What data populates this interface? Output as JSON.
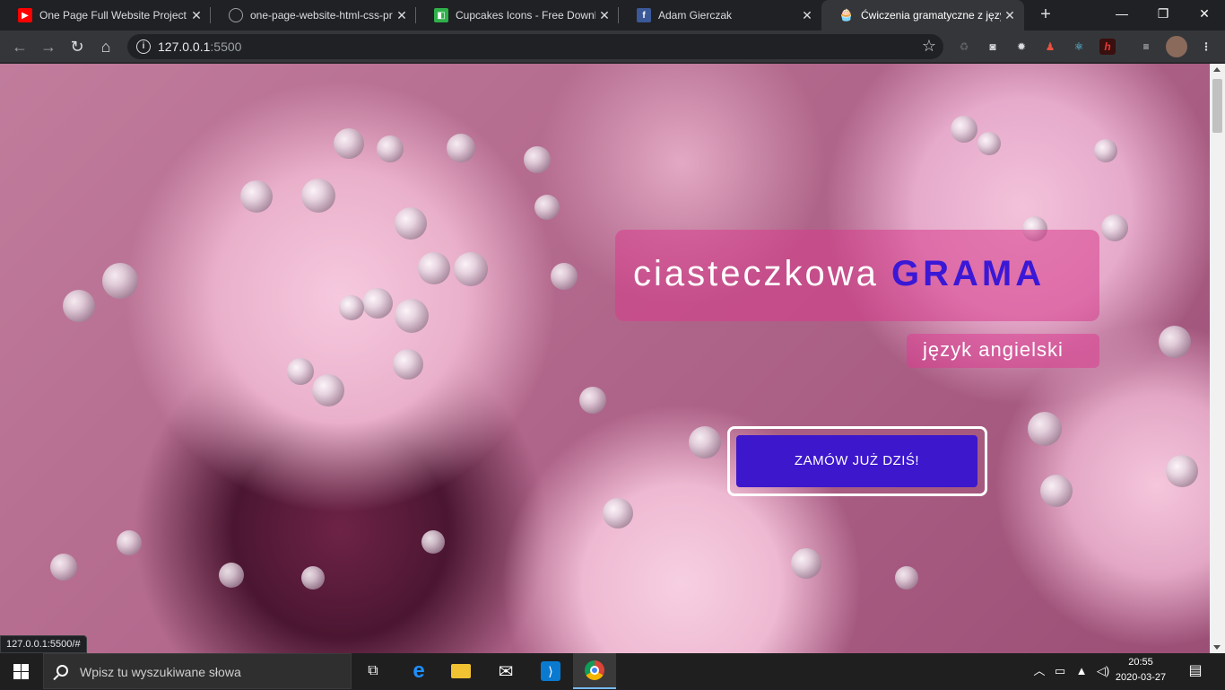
{
  "browser": {
    "tabs": [
      {
        "title": "One Page Full Website Project",
        "favicon": "youtube-icon"
      },
      {
        "title": "one-page-website-html-css-pr",
        "favicon": "github-icon"
      },
      {
        "title": "Cupcakes Icons - Free Downlo",
        "favicon": "cupcakes-site-icon"
      },
      {
        "title": "Adam Gierczak",
        "favicon": "facebook-icon"
      },
      {
        "title": "Ćwiczenia gramatyczne z język",
        "favicon": "cupcake-icon",
        "active": true
      }
    ],
    "window_controls": {
      "minimize": "—",
      "restore": "❐",
      "close": "✕"
    },
    "address": {
      "host": "127.0.0.1",
      "port": ":5500"
    }
  },
  "hero": {
    "title_light": "ciasteczkowa",
    "title_bold": "GRAMA",
    "subtitle": "język angielski",
    "cta_label": "ZAMÓW JUŻ DZIŚ!"
  },
  "status_url": "127.0.0.1:5500/#",
  "taskbar": {
    "search_placeholder": "Wpisz tu wyszukiwane słowa",
    "apps": [
      "task-view-icon",
      "edge-icon",
      "file-explorer-icon",
      "mail-icon",
      "vscode-icon",
      "chrome-icon"
    ],
    "clock_time": "20:55",
    "clock_date": "2020-03-27"
  },
  "colors": {
    "accent_blue": "#3c17cc",
    "title_box_pink": "#d73c8c",
    "chrome_dark": "#202124"
  }
}
